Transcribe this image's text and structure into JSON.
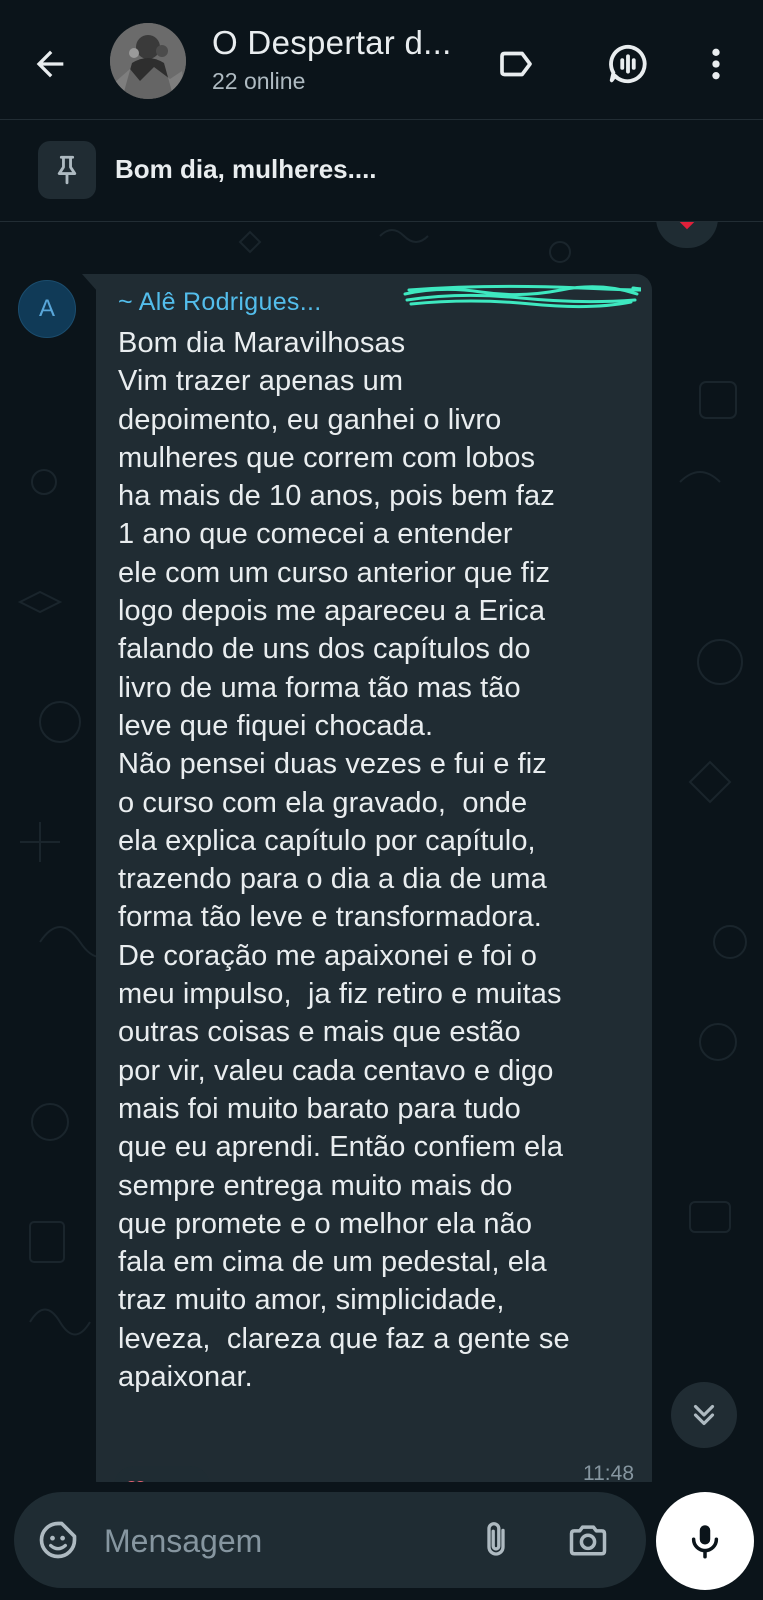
{
  "header": {
    "title": "O Despertar d...",
    "subtitle": "22 online",
    "icons": [
      "back-arrow-icon",
      "label-icon",
      "voice-chat-icon",
      "more-vertical-icon"
    ]
  },
  "pinned": {
    "text": "Bom dia, mulheres....",
    "icon": "pin-icon"
  },
  "message": {
    "avatar_letter": "A",
    "sender_name": "~ Alê Rodrigues...",
    "text": "Bom dia Maravilhosas\nVim trazer apenas um\ndepoimento, eu ganhei o livro\nmulheres que correm com lobos\nha mais de 10 anos, pois bem faz\n1 ano que comecei a entender\nele com um curso anterior que fiz\nlogo depois me apareceu a Erica\nfalando de uns dos capítulos do\nlivro de uma forma tão mas tão\nleve que fiquei chocada.\nNão pensei duas vezes e fui e fiz\no curso com ela gravado,  onde\nela explica capítulo por capítulo,\ntrazendo para o dia a dia de uma\nforma tão leve e transformadora.\nDe coração me apaixonei e foi o\nmeu impulso,  ja fiz retiro e muitas\noutras coisas e mais que estão\npor vir, valeu cada centavo e digo\nmais foi muito barato para tudo\nque eu aprendi. Então confiem ela\nsempre entrega muito mais do\nque promete e o melhor ela não\nfala em cima de um pedestal, ela\ntraz muito amor, simplicidade,\nleveza,  clareza que faz a gente se\napaixonar.",
    "time": "11:48"
  },
  "input": {
    "placeholder": "Mensagem"
  },
  "colors": {
    "background": "#0b141a",
    "bubble": "#202c33",
    "sender_name": "#53bdeb",
    "redaction_scribble": "#3ee8c0",
    "reaction_heart": "#e0203a"
  }
}
